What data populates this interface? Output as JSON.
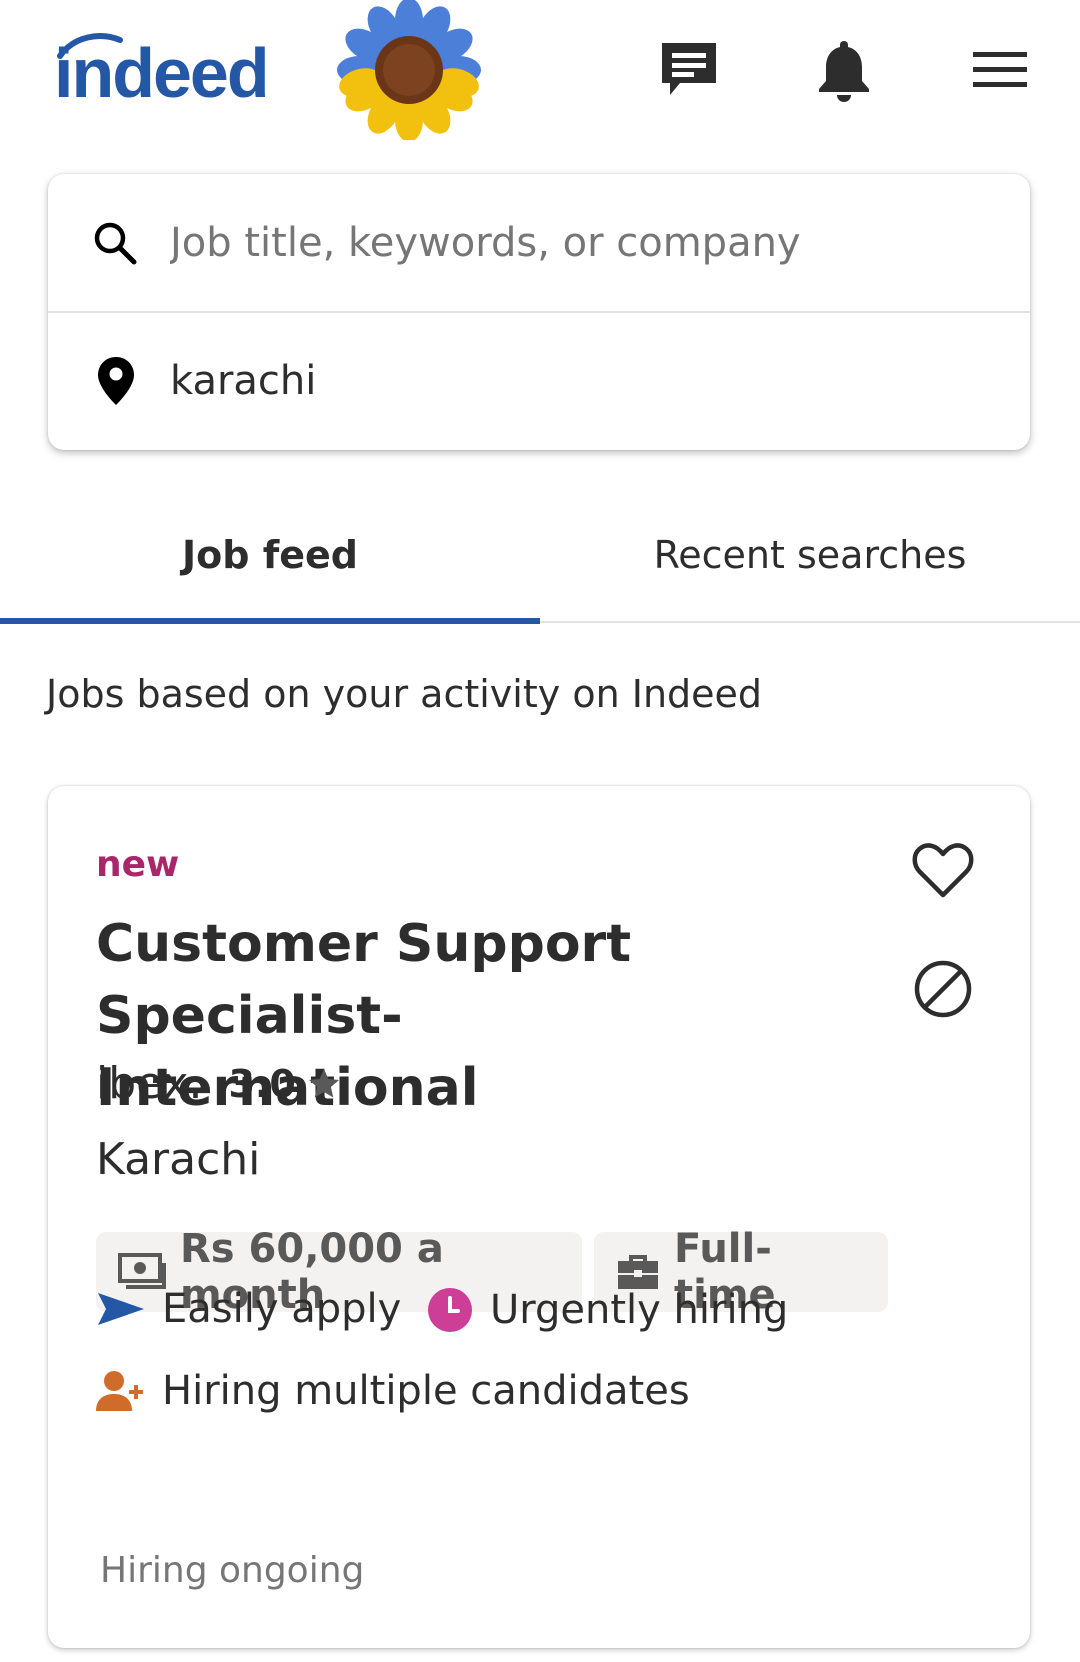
{
  "header": {
    "logo_text": "indeed",
    "icons": [
      "sunflower-icon",
      "messages-icon",
      "bell-icon",
      "menu-icon"
    ]
  },
  "search": {
    "keywords_placeholder": "Job title, keywords, or company",
    "keywords_value": "",
    "location_value": "karachi"
  },
  "tabs": [
    {
      "label": "Job feed",
      "active": true
    },
    {
      "label": "Recent searches",
      "active": false
    }
  ],
  "feed": {
    "heading": "Jobs based on your activity on Indeed"
  },
  "job": {
    "badge": "new",
    "title": "Customer Support Specialist-International",
    "company": "ibex.",
    "rating": "3.0",
    "location": "Karachi",
    "salary": "Rs 60,000 a month",
    "job_type": "Full-time",
    "attributes": {
      "easily_apply": "Easily apply",
      "urgently_hiring": "Urgently hiring",
      "multiple_candidates": "Hiring multiple candidates"
    },
    "status": "Hiring ongoing"
  },
  "colors": {
    "brand_blue": "#2557a7",
    "new_badge": "#a9266b",
    "urgent": "#cd3e97",
    "multi_candidates": "#d06b2a"
  }
}
